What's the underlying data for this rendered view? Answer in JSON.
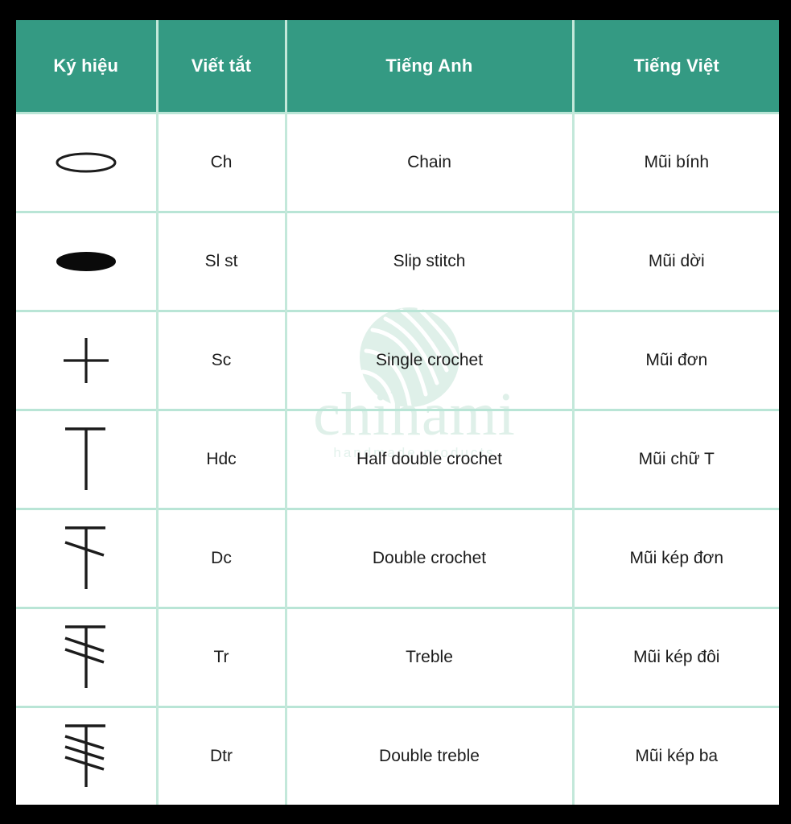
{
  "table": {
    "headers": [
      {
        "key": "symbol",
        "label": "Ký hiệu"
      },
      {
        "key": "abbr",
        "label": "Viết tắt"
      },
      {
        "key": "english",
        "label": "Tiếng Anh"
      },
      {
        "key": "viet",
        "label": "Tiếng Việt"
      }
    ],
    "rows": [
      {
        "symbol_icon": "chain-oval-open-icon",
        "abbr": "Ch",
        "english": "Chain",
        "viet": "Mũi bính"
      },
      {
        "symbol_icon": "slip-stitch-oval-filled-icon",
        "abbr": "Sl st",
        "english": "Slip stitch",
        "viet": "Mũi dời"
      },
      {
        "symbol_icon": "single-crochet-cross-icon",
        "abbr": "Sc",
        "english": "Single crochet",
        "viet": "Mũi đơn"
      },
      {
        "symbol_icon": "half-double-crochet-tee-icon",
        "abbr": "Hdc",
        "english": "Half double crochet",
        "viet": "Mũi chữ T"
      },
      {
        "symbol_icon": "double-crochet-one-slash-icon",
        "abbr": "Dc",
        "english": "Double crochet",
        "viet": "Mũi kép đơn"
      },
      {
        "symbol_icon": "treble-two-slash-icon",
        "abbr": "Tr",
        "english": "Treble",
        "viet": "Mũi kép đôi"
      },
      {
        "symbol_icon": "double-treble-three-slash-icon",
        "abbr": "Dtr",
        "english": "Double treble",
        "viet": "Mũi kép ba"
      }
    ]
  },
  "watermark": {
    "logo_icon": "yarn-ball-logo-icon",
    "wordmark": "chihami",
    "tagline": "handmade products"
  },
  "colors": {
    "header_background": "#349a83",
    "header_text": "#ffffff",
    "cell_border": "#b9e5d6",
    "cell_text": "#1c1c1c",
    "page_frame": "#000000",
    "card_background": "#ffffff",
    "watermark_text": "#dff0e9",
    "symbol_stroke": "#1c1c1c"
  }
}
